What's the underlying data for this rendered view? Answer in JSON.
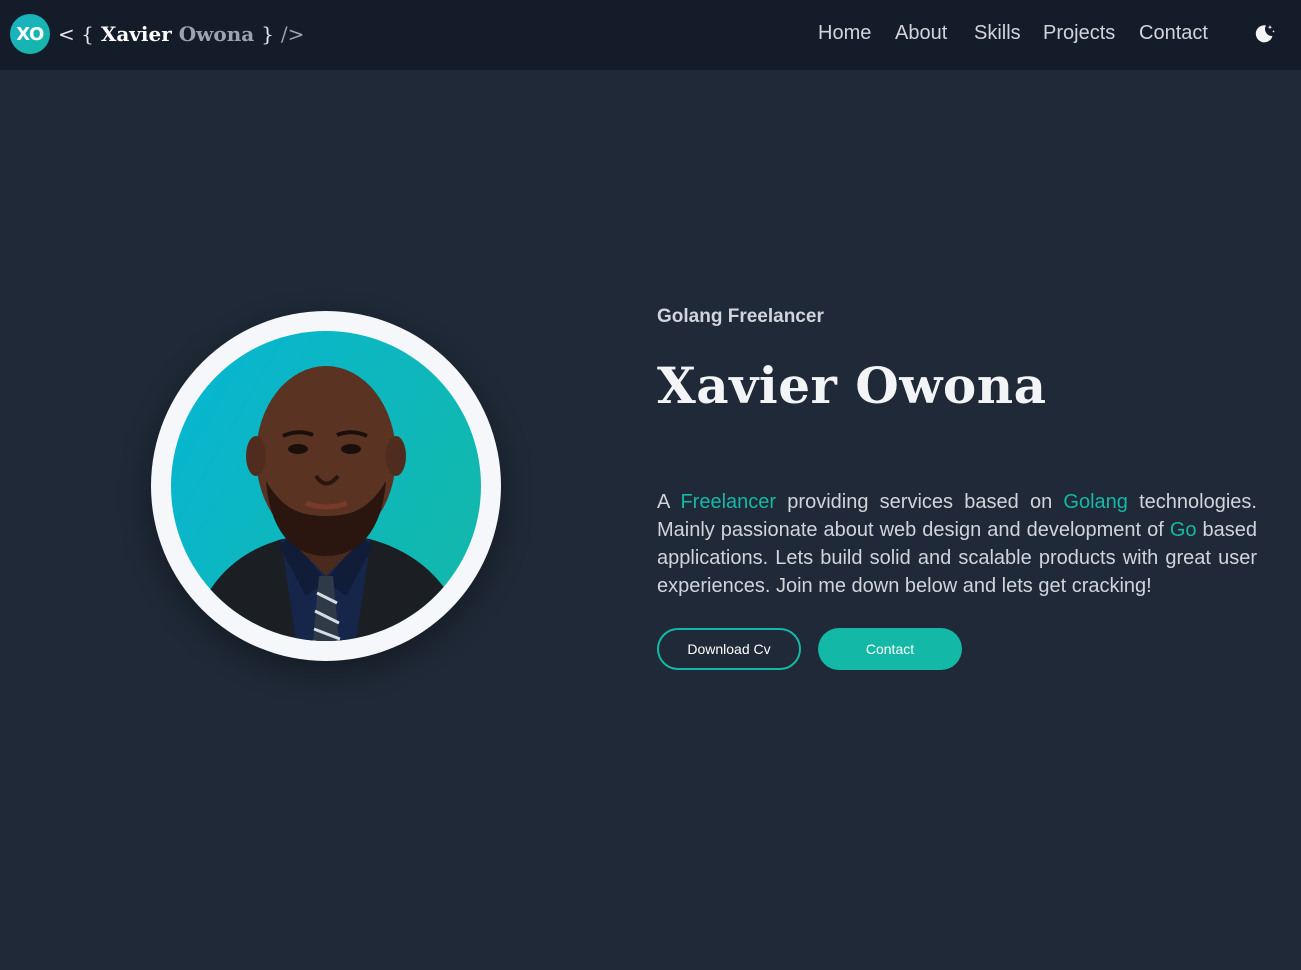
{
  "brand": {
    "badge": "XO",
    "open": "< {",
    "first": "Xavier",
    "last": "Owona",
    "close": "}",
    "slash": "/>"
  },
  "nav": {
    "items": [
      "Home",
      "About",
      "Skills",
      "Projects",
      "Contact"
    ],
    "theme_icon": "moon-stars-icon"
  },
  "hero": {
    "role": "Golang Freelancer",
    "name": "Xavier Owona",
    "intro": {
      "p1": "A",
      "h1": "Freelancer",
      "p2": "providing services based on",
      "h2": "Golang",
      "p3": "technologies. Mainly passionate about web design and development of",
      "h3": "Go",
      "p4": "based applications. Lets build solid and scalable products with great user experiences. Join me down below and lets get cracking!"
    },
    "buttons": {
      "download": "Download Cv",
      "contact": "Contact"
    },
    "photo_icon": "profile-photo"
  },
  "colors": {
    "background": "#1f2937",
    "navbar": "#141c2a",
    "accent": "#14b8a6",
    "ring": "#f5f7fb"
  }
}
